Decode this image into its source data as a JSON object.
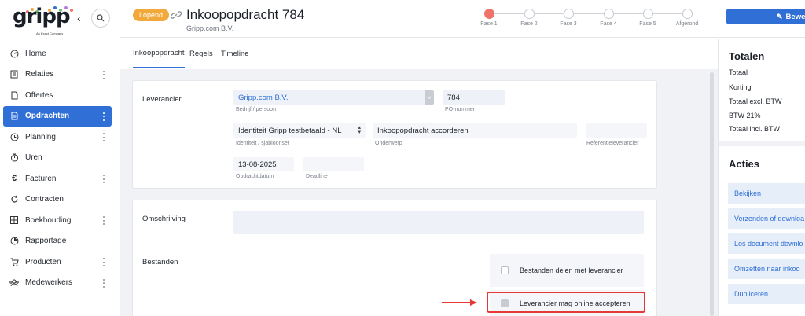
{
  "sidebar": {
    "logo": "gripp",
    "logo_sub": "An Exact Company",
    "items": [
      {
        "label": "Home",
        "icon": "dashboard-icon",
        "more": false
      },
      {
        "label": "Relaties",
        "icon": "building-icon",
        "more": true
      },
      {
        "label": "Offertes",
        "icon": "file-icon",
        "more": false
      },
      {
        "label": "Opdrachten",
        "icon": "document-icon",
        "more": true,
        "active": true
      },
      {
        "label": "Planning",
        "icon": "clock-icon",
        "more": true
      },
      {
        "label": "Uren",
        "icon": "stopwatch-icon",
        "more": false
      },
      {
        "label": "Facturen",
        "icon": "euro-icon",
        "more": true
      },
      {
        "label": "Contracten",
        "icon": "refresh-icon",
        "more": false
      },
      {
        "label": "Boekhouding",
        "icon": "grid-icon",
        "more": true
      },
      {
        "label": "Rapportage",
        "icon": "pie-chart-icon",
        "more": false
      },
      {
        "label": "Producten",
        "icon": "cart-icon",
        "more": true
      },
      {
        "label": "Medewerkers",
        "icon": "users-icon",
        "more": true
      }
    ]
  },
  "header": {
    "status": "Lopend",
    "title": "Inkoopopdracht 784",
    "subtitle": "Gripp.com B.V.",
    "edit_label": "Bewe",
    "phases": [
      "Fase 1",
      "Fase 2",
      "Fase 3",
      "Fase 4",
      "Fase 5",
      "Afgerond"
    ],
    "current_phase": 0
  },
  "tabs": [
    "Inkoopopdracht",
    "Regels",
    "Timeline"
  ],
  "form": {
    "leverancier_label": "Leverancier",
    "bedrijf_value": "Gripp.com B.V.",
    "bedrijf_label": "Bedrijf / persoon",
    "po_value": "784",
    "po_label": "PO-nummer",
    "identiteit_value": "Identiteit Gripp testbetaald - NL",
    "identiteit_label": "Identiteit / sjabloonset",
    "onderwerp_value": "Inkoopopdracht accorderen",
    "onderwerp_label": "Onderwerp",
    "referentie_value": "",
    "referentie_label": "Referentieleverancier",
    "datum_value": "13-08-2025",
    "datum_label": "Opdrachtdatum",
    "deadline_value": "",
    "deadline_label": "Deadline",
    "omschrijving_label": "Omschrijving",
    "bestanden_label": "Bestanden",
    "option_share": "Bestanden delen met leverancier",
    "option_accept": "Leverancier mag online accepteren"
  },
  "totals": {
    "title": "Totalen",
    "rows": [
      "Totaal",
      "Korting",
      "Totaal excl. BTW",
      "BTW 21%",
      "Totaal incl. BTW"
    ]
  },
  "actions": {
    "title": "Acties",
    "items": [
      "Bekijken",
      "Verzenden of downloa",
      "Los document downlo",
      "Omzetten naar inkoo",
      "Dupliceren"
    ]
  },
  "colors": {
    "accent": "#2f6fd6",
    "status": "#f2a93b",
    "current_phase": "#f0736b",
    "highlight": "#e53935"
  }
}
